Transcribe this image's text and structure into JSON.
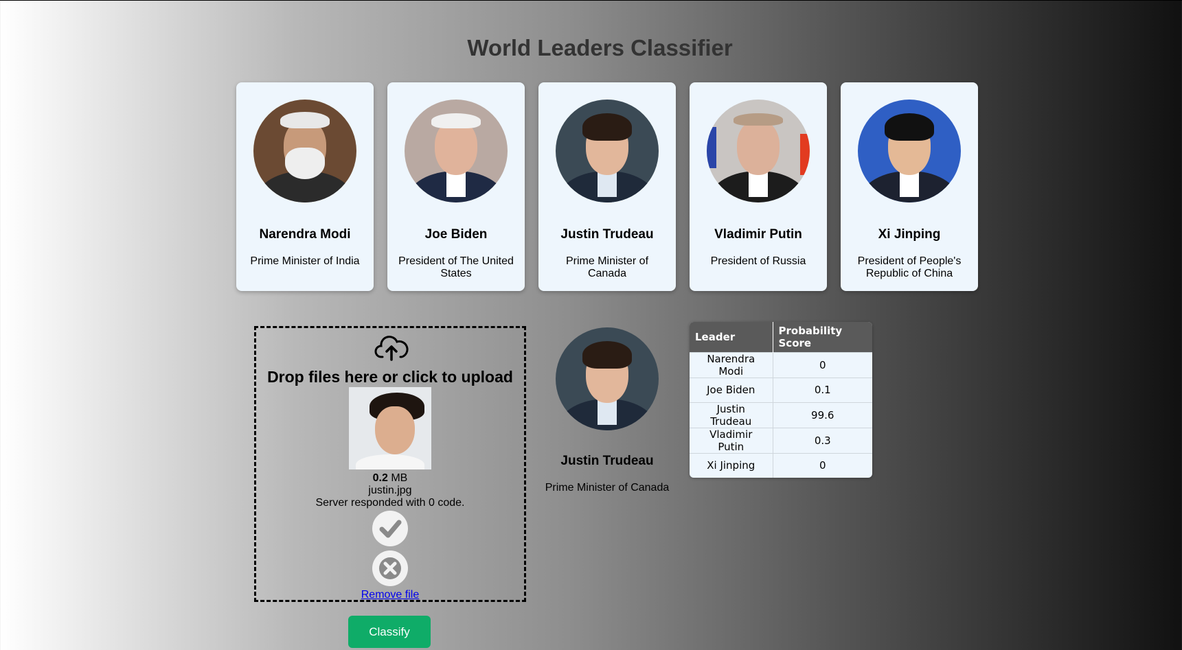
{
  "title": "World Leaders Classifier",
  "leaders": [
    {
      "name": "Narendra Modi",
      "role": "Prime Minister of India"
    },
    {
      "name": "Joe Biden",
      "role": "President of The United States"
    },
    {
      "name": "Justin Trudeau",
      "role": "Prime Minister of Canada"
    },
    {
      "name": "Vladimir Putin",
      "role": "President of Russia"
    },
    {
      "name": "Xi Jinping",
      "role": "President of People's Republic of China"
    }
  ],
  "upload": {
    "message": "Drop files here or click to upload",
    "file_size_value": "0.2",
    "file_size_unit": "MB",
    "file_name": "justin.jpg",
    "server_message": "Server responded with 0 code.",
    "remove_label": "Remove file",
    "icon": "cloud-upload-icon"
  },
  "classify_label": "Classify",
  "result": {
    "name": "Justin Trudeau",
    "role": "Prime Minister of Canada"
  },
  "table": {
    "headers": [
      "Leader",
      "Probability Score"
    ],
    "rows": [
      [
        "Narendra Modi",
        "0"
      ],
      [
        "Joe Biden",
        "0.1"
      ],
      [
        "Justin Trudeau",
        "99.6"
      ],
      [
        "Vladimir Putin",
        "0.3"
      ],
      [
        "Xi Jinping",
        "0"
      ]
    ]
  },
  "colors": {
    "classify_button": "#0fac68",
    "card_bg": "#eef6fd",
    "table_header": "#5a5a5a"
  }
}
